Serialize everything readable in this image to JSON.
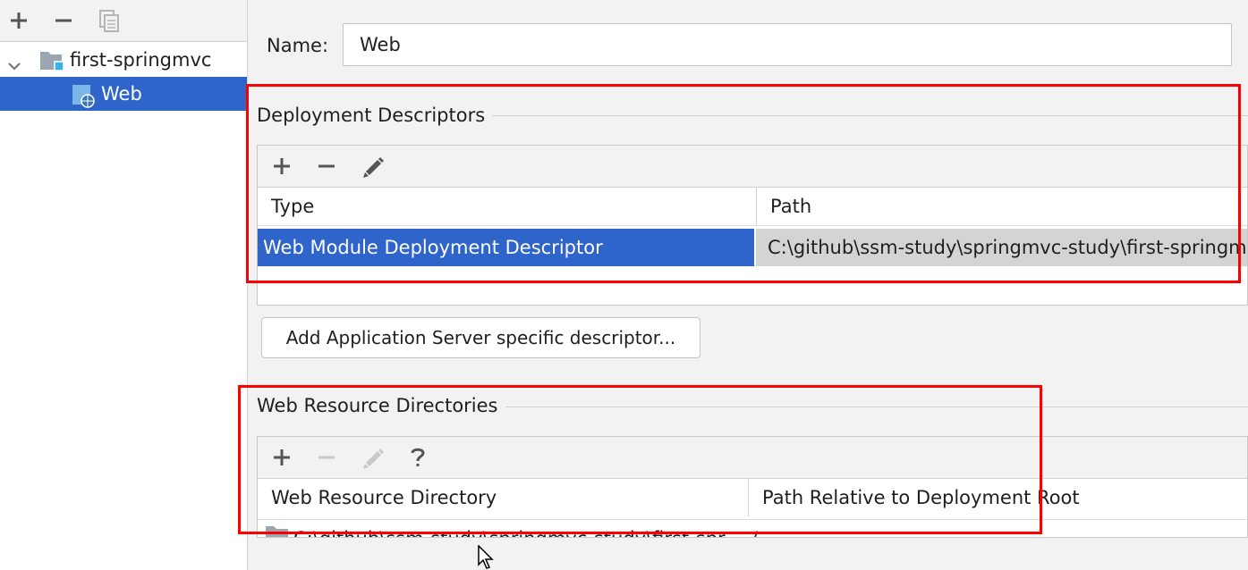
{
  "left_panel": {
    "toolbar": {
      "add_icon": "plus-icon",
      "remove_icon": "minus-icon",
      "copy_icon": "copy-icon"
    },
    "tree": [
      {
        "label": "first-springmvc",
        "icon": "module-folder-icon",
        "expanded": true
      },
      {
        "label": "Web",
        "icon": "web-facet-icon",
        "selected": true
      }
    ]
  },
  "name_field": {
    "label": "Name:",
    "value": "Web"
  },
  "deployment_descriptors": {
    "title": "Deployment Descriptors",
    "toolbar": [
      "plus-icon",
      "minus-icon",
      "pencil-icon"
    ],
    "columns": [
      "Type",
      "Path"
    ],
    "rows": [
      {
        "type": "Web Module Deployment Descriptor",
        "path": "C:\\github\\ssm-study\\springmvc-study\\first-springmvc"
      }
    ]
  },
  "add_server_button": {
    "label": "Add Application Server specific descriptor..."
  },
  "web_resource_directories": {
    "title": "Web Resource Directories",
    "toolbar": [
      "plus-icon",
      "minus-icon",
      "pencil-icon",
      "question-icon"
    ],
    "columns": [
      "Web Resource Directory",
      "Path Relative to Deployment Root"
    ],
    "rows": [
      {
        "directory": "C:\\github\\ssm-study\\springmvc-study\\first-springmvc",
        "relative_path": "/"
      }
    ]
  },
  "colors": {
    "selection": "#2f65ca",
    "highlight_border": "#ff0000",
    "panel_bg": "#f2f2f2"
  }
}
